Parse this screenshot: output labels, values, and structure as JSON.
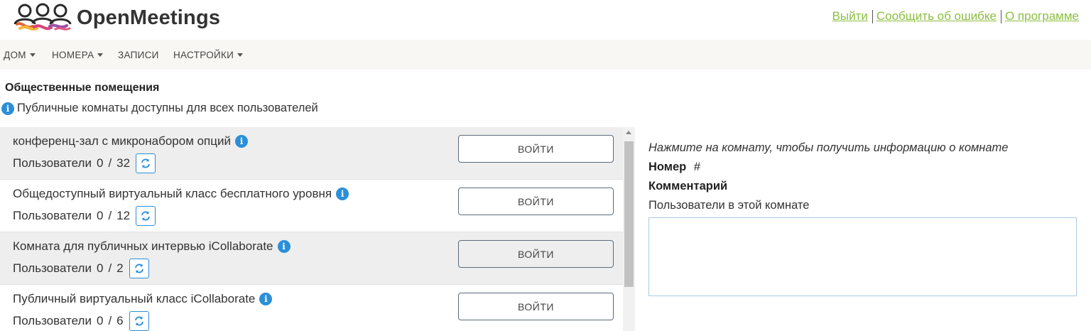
{
  "header": {
    "app_name": "OpenMeetings",
    "links": [
      {
        "label": "Выйти "
      },
      {
        "label": "Сообщить об ошибке "
      },
      {
        "label": "О программе"
      }
    ]
  },
  "menu": {
    "items": [
      {
        "label": "ДОМ",
        "has_caret": true
      },
      {
        "label": "НОМЕРА",
        "has_caret": true
      },
      {
        "label": "ЗАПИСИ",
        "has_caret": false
      },
      {
        "label": "НАСТРОЙКИ",
        "has_caret": true
      }
    ]
  },
  "section": {
    "title": "Общественные помещения",
    "description": "Публичные комнаты доступны для всех пользователей"
  },
  "rooms": [
    {
      "name": "конференц-зал с микронабором опций",
      "users_label": "Пользователи",
      "current": "0",
      "separator": "/",
      "capacity": "32",
      "enter_label": "ВОЙТИ"
    },
    {
      "name": "Общедоступный виртуальный класс бесплатного уровня",
      "users_label": "Пользователи",
      "current": "0",
      "separator": "/",
      "capacity": "12",
      "enter_label": "ВОЙТИ"
    },
    {
      "name": "Комната для публичных интервью iCollaborate",
      "users_label": "Пользователи",
      "current": "0",
      "separator": "/",
      "capacity": "2",
      "enter_label": "ВОЙТИ"
    },
    {
      "name": "Публичный виртуальный класс iCollaborate",
      "users_label": "Пользователи",
      "current": "0",
      "separator": "/",
      "capacity": "6",
      "enter_label": "ВОЙТИ"
    }
  ],
  "room_info": {
    "hint": "Нажмите на комнату, чтобы получить информацию о комнате",
    "number_label": "Номер",
    "number_value": "#",
    "comment_label": "Комментарий",
    "users_label": "Пользователи в этой комнате"
  },
  "colors": {
    "link": "#8bbf3f",
    "accent": "#2b8fd8",
    "menubar_bg": "#f8f7f4"
  }
}
